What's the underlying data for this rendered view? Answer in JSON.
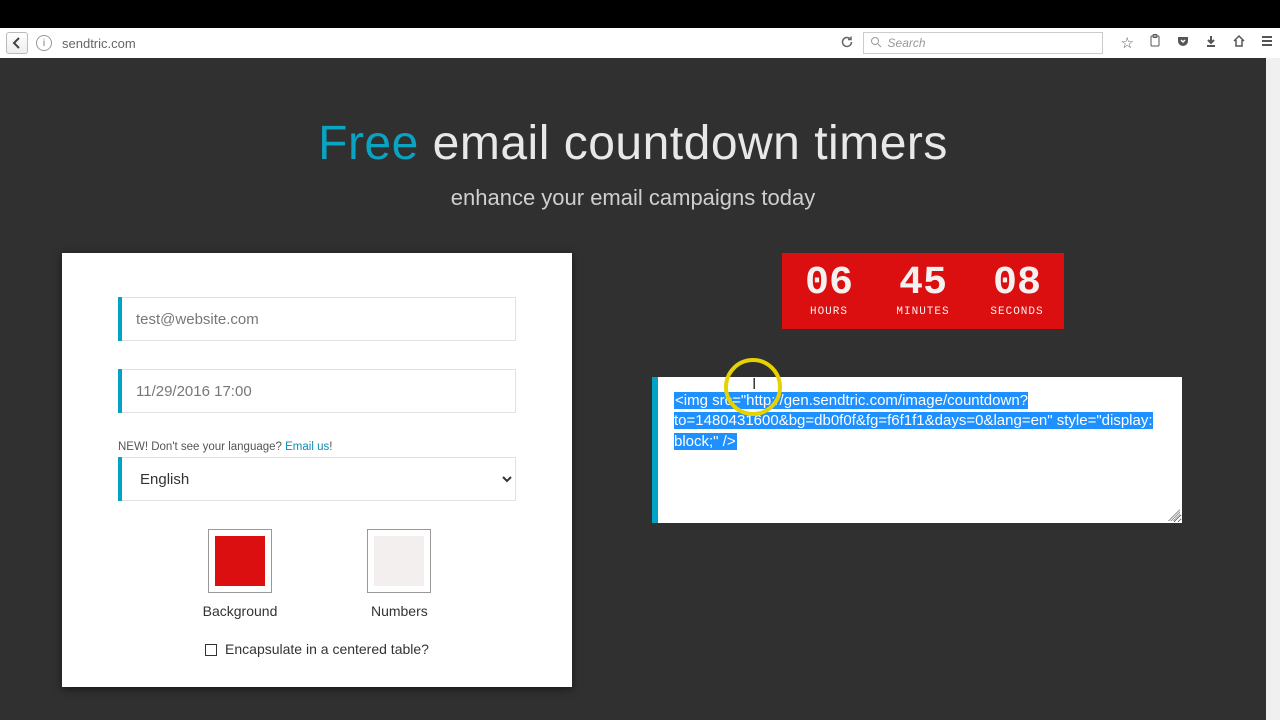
{
  "browser": {
    "url": "sendtric.com",
    "search_placeholder": "Search"
  },
  "hero": {
    "accent": "Free",
    "rest": " email countdown timers",
    "sub": "enhance your email campaigns today"
  },
  "form": {
    "email_value": "test@website.com",
    "date_value": "11/29/2016 17:00",
    "lang_note_pre": "NEW! Don't see your language? ",
    "lang_note_link": "Email us",
    "lang_note_post": "!",
    "language": "English",
    "swatch_bg_label": "Background",
    "swatch_bg_color": "#db0f0f",
    "swatch_fg_label": "Numbers",
    "swatch_fg_color": "#f4efef",
    "encapsulate_label": "Encapsulate in a centered table?"
  },
  "timer": {
    "hours": "06",
    "minutes": "45",
    "seconds": "08",
    "hours_label": "HOURS",
    "minutes_label": "MINUTES",
    "seconds_label": "SECONDS"
  },
  "code": {
    "snippet": "<img src=\"http://gen.sendtric.com/image/countdown?to=1480431600&bg=db0f0f&fg=f6f1f1&days=0&lang=en\" style=\"display: block;\" />"
  }
}
